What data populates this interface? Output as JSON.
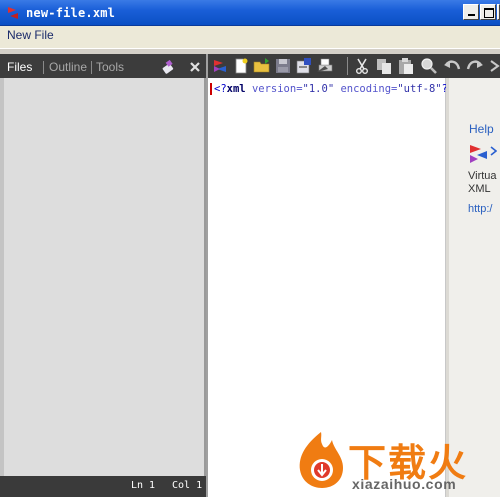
{
  "window": {
    "title": "new-file.xml"
  },
  "menu": {
    "items": [
      "New File"
    ]
  },
  "left_panel": {
    "tabs": [
      {
        "label": "Files",
        "active": true
      },
      {
        "label": "Outline",
        "active": false
      },
      {
        "label": "Tools",
        "active": false
      }
    ]
  },
  "toolbar": {
    "buttons": [
      "app-logo-icon",
      "new-file-icon",
      "open-folder-icon",
      "save-icon",
      "save-as-icon",
      "print-icon",
      "cut-icon",
      "copy-icon",
      "paste-icon",
      "find-icon",
      "undo-icon",
      "redo-icon",
      "more-icon"
    ]
  },
  "editor": {
    "xml_decl_open": "<?",
    "xml_keyword": "xml",
    "attr1": " version=",
    "val1": "\"1.0\"",
    "attr2": " encoding=",
    "val2": "\"utf-8\"",
    "xml_decl_close": "?>"
  },
  "status": {
    "line": "Ln 1",
    "col": "Col 1"
  },
  "help_panel": {
    "title": "Help",
    "text_line1": "Virtua",
    "text_line2": "XML",
    "link": "http:/"
  },
  "watermark": {
    "chinese": "下载火",
    "url": "xiazaihuo.com"
  },
  "colors": {
    "titlebar": "#1a5fd8",
    "dark_bar": "#3c3c3c",
    "link": "#2a60c0",
    "watermark": "#f07c12"
  }
}
